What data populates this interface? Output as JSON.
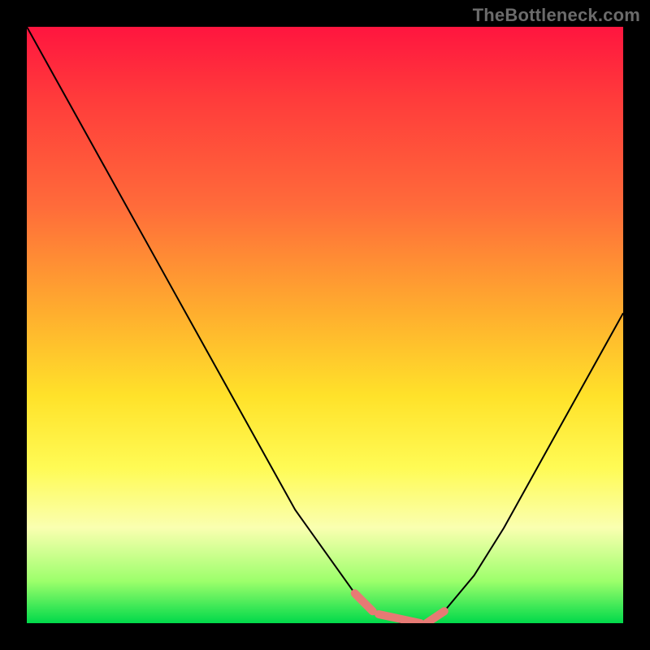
{
  "watermark": "TheBottleneck.com",
  "colors": {
    "background": "#000000",
    "curve": "#000000",
    "highlight": "#e77a74",
    "gradient_top": "#ff153f",
    "gradient_bottom": "#00d94a"
  },
  "chart_data": {
    "type": "line",
    "title": "",
    "xlabel": "",
    "ylabel": "",
    "xlim": [
      0,
      100
    ],
    "ylim": [
      0,
      100
    ],
    "series": [
      {
        "name": "curve",
        "x": [
          0,
          5,
          10,
          15,
          20,
          25,
          30,
          35,
          40,
          45,
          50,
          55,
          58,
          60,
          63,
          65,
          67,
          70,
          75,
          80,
          85,
          90,
          95,
          100
        ],
        "values": [
          100,
          91,
          82,
          73,
          64,
          55,
          46,
          37,
          28,
          19,
          12,
          5,
          2,
          1,
          0,
          0,
          0,
          2,
          8,
          16,
          25,
          34,
          43,
          52
        ]
      }
    ],
    "highlight_x_range": [
      55,
      70
    ],
    "annotations": []
  }
}
